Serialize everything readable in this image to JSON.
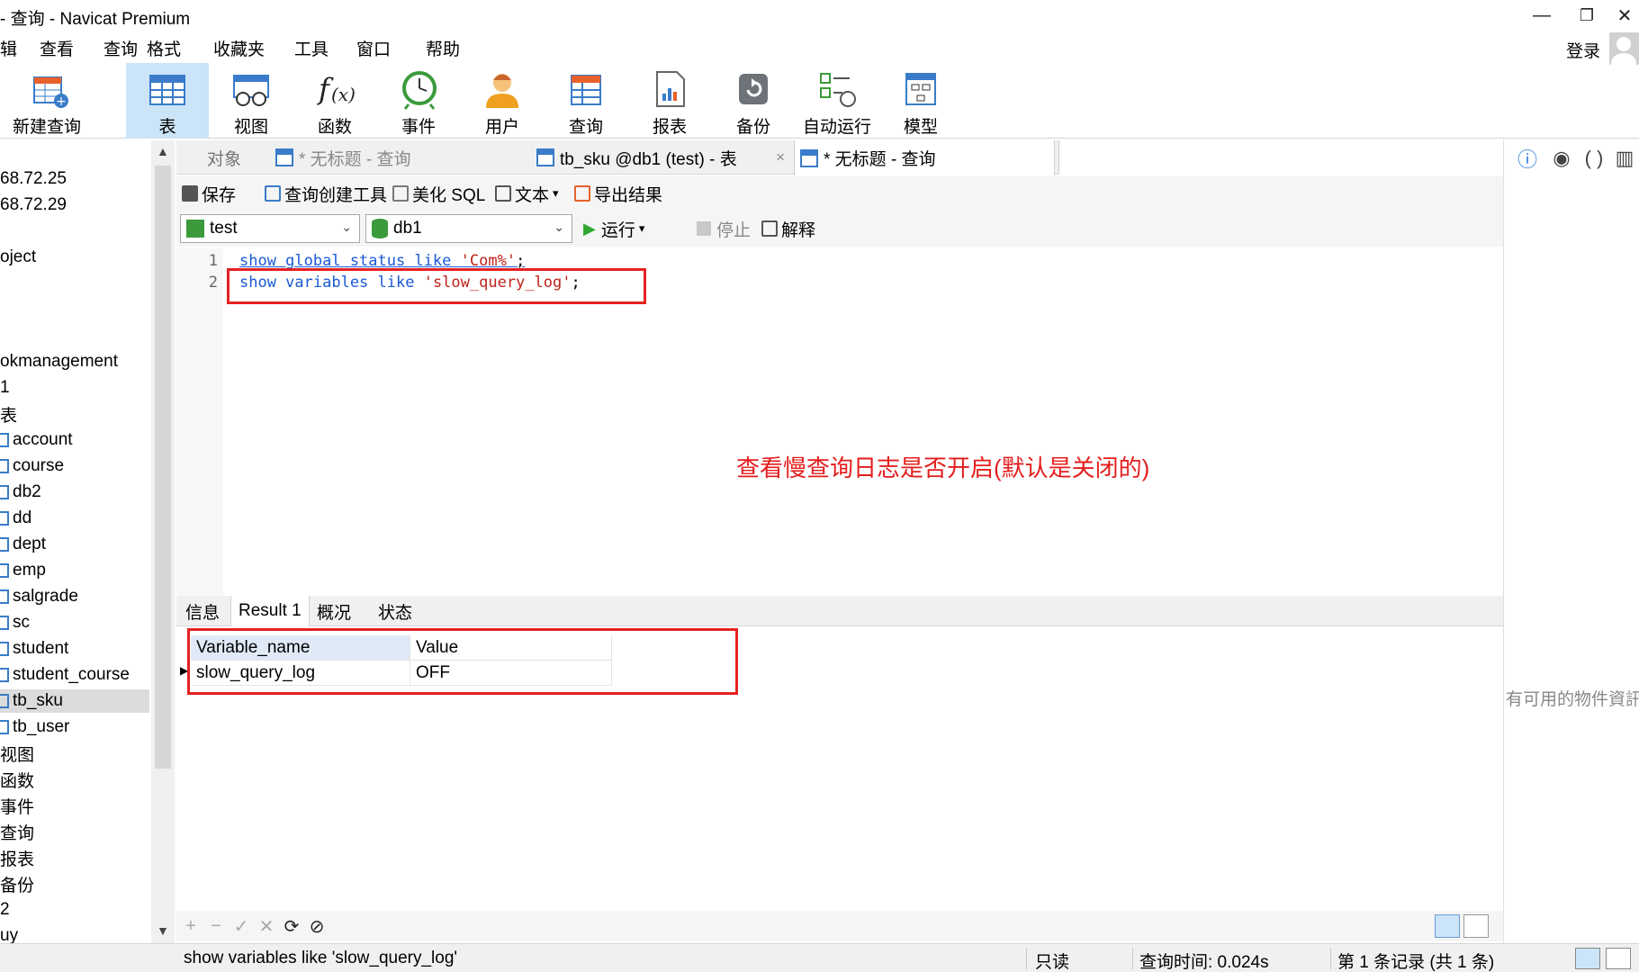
{
  "window": {
    "title": "- 查询 - Navicat Premium",
    "minimize": "—",
    "restore": "❐",
    "close": "✕"
  },
  "menu": {
    "items": [
      "辑",
      "查看",
      "查询",
      "格式",
      "收藏夹",
      "工具",
      "窗口",
      "帮助"
    ],
    "login": "登录"
  },
  "toolbar": {
    "new_query": "新建查询",
    "tools": [
      "表",
      "视图",
      "函数",
      "事件",
      "用户",
      "查询",
      "报表",
      "备份",
      "自动运行",
      "模型"
    ],
    "active_tool": "表"
  },
  "sidebar": {
    "items": [
      "68.72.25",
      "68.72.29",
      "oject",
      "okmanagement",
      "1",
      "表",
      "account",
      "course",
      "db2",
      "dd",
      "dept",
      "emp",
      "salgrade",
      "sc",
      "student",
      "student_course",
      "tb_sku",
      "tb_user",
      "视图",
      "函数",
      "事件",
      "查询",
      "报表",
      "备份",
      "2",
      "uy"
    ],
    "selected": "tb_sku"
  },
  "tabs": {
    "objects": "对象",
    "query1": "* 无标题 - 查询",
    "table": "tb_sku @db1 (test) - 表",
    "table_close": "×",
    "query2": "* 无标题 - 查询"
  },
  "editor_toolbar": {
    "save": "保存",
    "builder": "查询创建工具",
    "beautify": "美化 SQL",
    "text": "文本",
    "text_arrow": "▾",
    "export": "导出结果"
  },
  "selectors": {
    "connection": "test",
    "database": "db1",
    "run": "运行",
    "run_arrow": "▾",
    "stop": "停止",
    "explain": "解释"
  },
  "editor": {
    "line_numbers": [
      "1",
      "2"
    ],
    "line1": {
      "kw": "show global status like ",
      "str": "'Com%'",
      "end": ";"
    },
    "line2": {
      "kw": "show variables like ",
      "str": "'slow_query_log'",
      "end": ";"
    }
  },
  "annotation": "查看慢查询日志是否开启(默认是关闭的)",
  "right_panel": {
    "icons": [
      "info-icon",
      "eye-icon",
      "parens-icon",
      "panel-icon"
    ],
    "message": "有可用的物件資訊"
  },
  "result_tabs": {
    "items": [
      "信息",
      "Result 1",
      "概况",
      "状态"
    ],
    "active": "Result 1"
  },
  "grid": {
    "columns": [
      "Variable_name",
      "Value"
    ],
    "rows": [
      [
        "slow_query_log",
        "OFF"
      ]
    ]
  },
  "grid_footer": {
    "add": "+",
    "remove": "−",
    "apply": "✓",
    "discard": "✕",
    "refresh": "⟳",
    "stop": "⊘"
  },
  "status": {
    "sql": "show variables like 'slow_query_log'",
    "readonly": "只读",
    "query_time": "查询时间: 0.024s",
    "records": "第 1 条记录 (共 1 条)"
  },
  "colors": {
    "accent": "#3a7cc9",
    "highlight": "#e52222",
    "selection": "#cce4f7"
  }
}
